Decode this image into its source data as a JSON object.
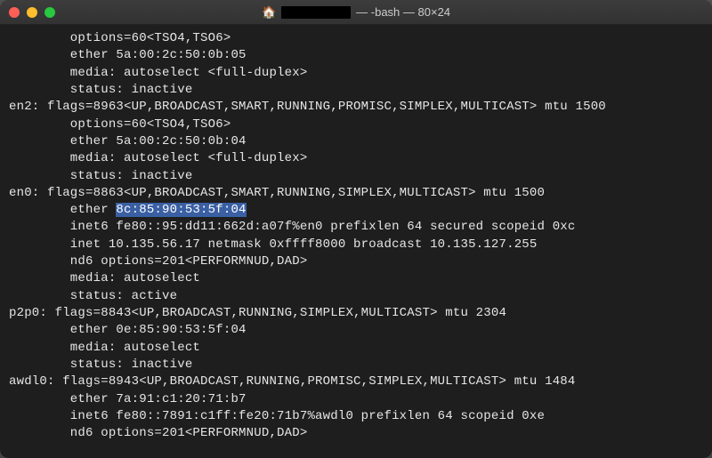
{
  "window": {
    "title_suffix": " — -bash — 80×24"
  },
  "terminal": {
    "lines": [
      "        options=60<TSO4,TSO6>",
      "        ether 5a:00:2c:50:0b:05",
      "        media: autoselect <full-duplex>",
      "        status: inactive",
      "en2: flags=8963<UP,BROADCAST,SMART,RUNNING,PROMISC,SIMPLEX,MULTICAST> mtu 1500",
      "        options=60<TSO4,TSO6>",
      "        ether 5a:00:2c:50:0b:04",
      "        media: autoselect <full-duplex>",
      "        status: inactive",
      "en0: flags=8863<UP,BROADCAST,SMART,RUNNING,SIMPLEX,MULTICAST> mtu 1500",
      "        ether ",
      "        inet6 fe80::95:dd11:662d:a07f%en0 prefixlen 64 secured scopeid 0xc",
      "        inet 10.135.56.17 netmask 0xffff8000 broadcast 10.135.127.255",
      "        nd6 options=201<PERFORMNUD,DAD>",
      "        media: autoselect",
      "        status: active",
      "p2p0: flags=8843<UP,BROADCAST,RUNNING,SIMPLEX,MULTICAST> mtu 2304",
      "        ether 0e:85:90:53:5f:04",
      "        media: autoselect",
      "        status: inactive",
      "awdl0: flags=8943<UP,BROADCAST,RUNNING,PROMISC,SIMPLEX,MULTICAST> mtu 1484",
      "        ether 7a:91:c1:20:71:b7",
      "        inet6 fe80::7891:c1ff:fe20:71b7%awdl0 prefixlen 64 scopeid 0xe",
      "        nd6 options=201<PERFORMNUD,DAD>"
    ],
    "selection": {
      "line_index": 10,
      "text": "8c:85:90:53:5f:04"
    }
  }
}
